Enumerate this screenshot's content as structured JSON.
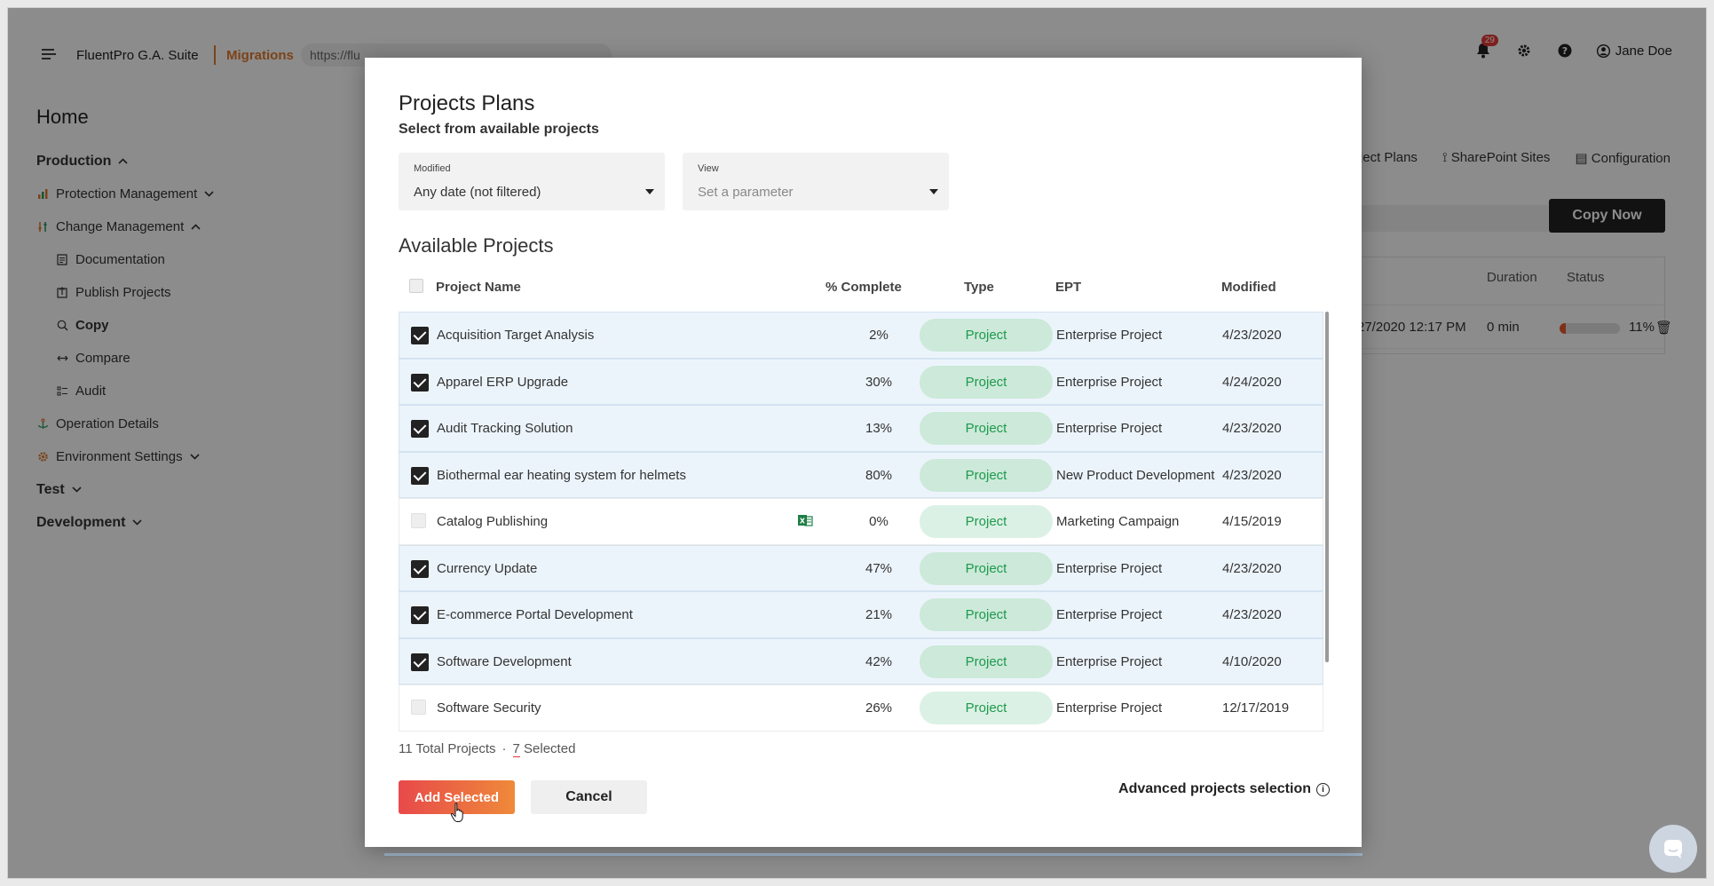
{
  "topbar": {
    "brand": "FluentPro G.A. Suite",
    "module": "Migrations",
    "url": "https://flu",
    "notifications_count": "29",
    "user_name": "Jane Doe"
  },
  "sidebar": {
    "home": "Home",
    "items": [
      {
        "label": "Production",
        "kind": "section",
        "chevron": "up"
      },
      {
        "label": "Protection Management",
        "kind": "item",
        "icon": "chart-icon",
        "chevron": "down"
      },
      {
        "label": "Change Management",
        "kind": "item",
        "icon": "sliders-icon",
        "chevron": "up"
      },
      {
        "label": "Documentation",
        "kind": "sub",
        "icon": "document-icon"
      },
      {
        "label": "Publish Projects",
        "kind": "sub",
        "icon": "publish-icon"
      },
      {
        "label": "Copy",
        "kind": "sub",
        "icon": "copy-icon",
        "active": true
      },
      {
        "label": "Compare",
        "kind": "sub",
        "icon": "compare-icon"
      },
      {
        "label": "Audit",
        "kind": "sub",
        "icon": "audit-icon"
      },
      {
        "label": "Operation Details",
        "kind": "item",
        "icon": "anchor-icon"
      },
      {
        "label": "Environment Settings",
        "kind": "item",
        "icon": "gear-icon",
        "chevron": "down"
      },
      {
        "label": "Test",
        "kind": "section",
        "chevron": "down"
      },
      {
        "label": "Development",
        "kind": "section",
        "chevron": "down"
      }
    ]
  },
  "background": {
    "tabs": [
      "oject Plans",
      "SharePoint Sites",
      "Configuration"
    ],
    "copy_now": "Copy Now",
    "table_headers": [
      "t",
      "Duration",
      "Status"
    ],
    "row": {
      "date": "27/2020 12:17 PM",
      "duration": "0 min",
      "status_pct": "11%",
      "progress": 0.11
    }
  },
  "modal": {
    "title": "Projects Plans",
    "subtitle": "Select from available projects",
    "filters": [
      {
        "label": "Modified",
        "value": "Any date (not filtered)",
        "placeholder": false
      },
      {
        "label": "View",
        "value": "Set a parameter",
        "placeholder": true
      }
    ],
    "section_title": "Available Projects",
    "columns": [
      "Project Name",
      "% Complete",
      "Type",
      "EPT",
      "Modified"
    ],
    "rows": [
      {
        "name": "Acquisition Target Analysis",
        "pct": "2%",
        "type": "Project",
        "ept": "Enterprise Project",
        "modified": "4/23/2020",
        "selected": true
      },
      {
        "name": "Apparel ERP Upgrade",
        "pct": "30%",
        "type": "Project",
        "ept": "Enterprise Project",
        "modified": "4/24/2020",
        "selected": true
      },
      {
        "name": "Audit Tracking Solution",
        "pct": "13%",
        "type": "Project",
        "ept": "Enterprise Project",
        "modified": "4/23/2020",
        "selected": true
      },
      {
        "name": "Biothermal ear heating system for helmets",
        "pct": "80%",
        "type": "Project",
        "ept": "New Product Development",
        "modified": "4/23/2020",
        "selected": true
      },
      {
        "name": "Catalog Publishing",
        "pct": "0%",
        "type": "Project",
        "ept": "Marketing Campaign",
        "modified": "4/15/2019",
        "selected": false,
        "has_icon": true
      },
      {
        "name": "Currency Update",
        "pct": "47%",
        "type": "Project",
        "ept": "Enterprise Project",
        "modified": "4/23/2020",
        "selected": true
      },
      {
        "name": "E-commerce Portal Development",
        "pct": "21%",
        "type": "Project",
        "ept": "Enterprise Project",
        "modified": "4/23/2020",
        "selected": true
      },
      {
        "name": "Software Development",
        "pct": "42%",
        "type": "Project",
        "ept": "Enterprise Project",
        "modified": "4/10/2020",
        "selected": true
      },
      {
        "name": "Software Security",
        "pct": "26%",
        "type": "Project",
        "ept": "Enterprise Project",
        "modified": "12/17/2019",
        "selected": false
      }
    ],
    "total_label": "11 Total Projects",
    "selected_count": "7",
    "selected_word": "Selected",
    "add_button": "Add Selected",
    "cancel_button": "Cancel",
    "advanced_link": "Advanced projects selection"
  }
}
